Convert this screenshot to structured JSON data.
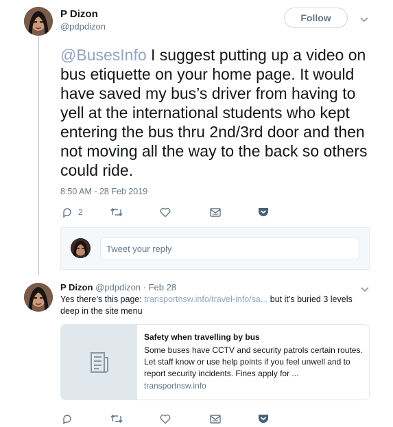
{
  "tweet": {
    "author_name": "P Dizon",
    "author_handle": "@pdpdizon",
    "follow_label": "Follow",
    "mention": "@BusesInfo",
    "text": " I suggest putting up a video on bus etiquette on your home page. It would have saved my bus’s driver from having to yell at the international students who kept entering the bus thru 2nd/3rd door and then not moving all the way to the back so others could ride.",
    "timestamp": "8:50 AM - 28 Feb 2019",
    "reply_count": "2"
  },
  "reply_box": {
    "placeholder": "Tweet your reply"
  },
  "reply": {
    "author_name": "P Dizon",
    "author_handle": "@pdpdizon",
    "date_sep": " · ",
    "date": "Feb 28",
    "text_before": "Yes there’s this page: ",
    "link": "transportnsw.info/travel-info/sa...",
    "text_after": " but it’s buried 3 levels deep in the site menu",
    "card": {
      "title": "Safety when travelling by bus",
      "description": "Some buses have CCTV and security patrols certain routes. Let staff know or use help points if you feel unwell and to report security incidents. Fines apply for ...",
      "domain": "transportnsw.info"
    }
  },
  "icons": {
    "reply": "reply-icon",
    "retweet": "retweet-icon",
    "like": "heart-icon",
    "dm": "envelope-icon",
    "save": "pocket-icon",
    "chevron": "chevron-down-icon",
    "article": "document-icon"
  },
  "colors": {
    "link": "#8fa6c2",
    "secondary": "#657786",
    "save_icon": "#4a5f7a"
  }
}
